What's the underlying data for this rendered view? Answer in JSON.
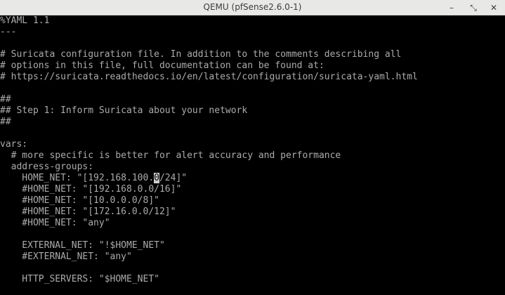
{
  "window": {
    "title": "QEMU (pfSense2.6.0-1)",
    "minimize_glyph": "–",
    "maximize_glyph": "⤡",
    "close_glyph": "✕"
  },
  "terminal": {
    "foreground": "#ababab",
    "background": "#000000",
    "lines": [
      "%YAML 1.1",
      "---",
      "",
      "# Suricata configuration file. In addition to the comments describing all",
      "# options in this file, full documentation can be found at:",
      "# https://suricata.readthedocs.io/en/latest/configuration/suricata-yaml.html",
      "",
      "##",
      "## Step 1: Inform Suricata about your network",
      "##",
      "",
      "vars:",
      "  # more specific is better for alert accuracy and performance",
      "  address-groups:",
      "    HOME_NET: \"[192.168.100.",
      "    #HOME_NET: \"[192.168.0.0/16]\"",
      "    #HOME_NET: \"[10.0.0.0/8]\"",
      "    #HOME_NET: \"[172.16.0.0/12]\"",
      "    #HOME_NET: \"any\"",
      "",
      "    EXTERNAL_NET: \"!$HOME_NET\"",
      "    #EXTERNAL_NET: \"any\"",
      "",
      "    HTTP_SERVERS: \"$HOME_NET\""
    ],
    "cursor_line": {
      "before": "    HOME_NET: \"[192.168.100.",
      "cursor_char": "0",
      "after": "/24]\""
    }
  }
}
